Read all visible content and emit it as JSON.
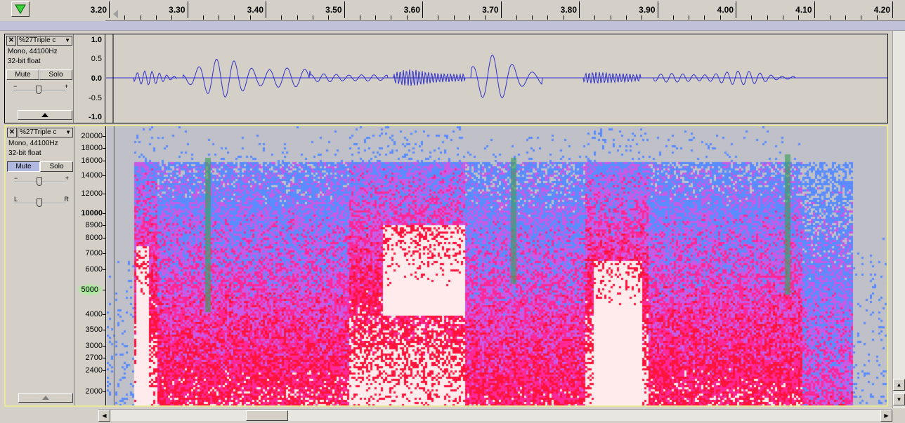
{
  "ruler": {
    "ticks": [
      "3.20",
      "3.30",
      "3.40",
      "3.50",
      "3.60",
      "3.70",
      "3.80",
      "3.90",
      "4.00",
      "4.10",
      "4.20"
    ]
  },
  "tracks": [
    {
      "name": "%27Triple c",
      "info_line1": "Mono, 44100Hz",
      "info_line2": "32-bit float",
      "mute_label": "Mute",
      "solo_label": "Solo",
      "view": "waveform",
      "mute_active": false,
      "waveform_color": "#3232c8",
      "amp_labels": [
        "1.0",
        "0.5",
        "0.0",
        "-0.5",
        "-1.0"
      ]
    },
    {
      "name": "%27Triple c",
      "info_line1": "Mono, 44100Hz",
      "info_line2": "32-bit float",
      "mute_label": "Mute",
      "solo_label": "Solo",
      "view": "spectrogram",
      "mute_active": true,
      "gain_l": "L",
      "gain_r": "R",
      "freq_labels": [
        "20000",
        "18000",
        "16000",
        "14000",
        "12000",
        "10000",
        "8900",
        "8000",
        "7000",
        "6000",
        "5000",
        "4000",
        "3500",
        "3000",
        "2700",
        "2400",
        "2000"
      ],
      "highlighted_freq": "5000"
    }
  ],
  "colors": {
    "spectro_low": "#c0c0c8",
    "spectro_mid": "#5a8cff",
    "spectro_high": "#ff2a6a",
    "spectro_peak": "#ffffff",
    "selection_border": "#e8e89a"
  },
  "icons": {
    "play_head": "green-down-triangle-icon",
    "close": "close-icon",
    "dropdown": "chevron-down-icon",
    "collapse": "collapse-up-icon"
  }
}
